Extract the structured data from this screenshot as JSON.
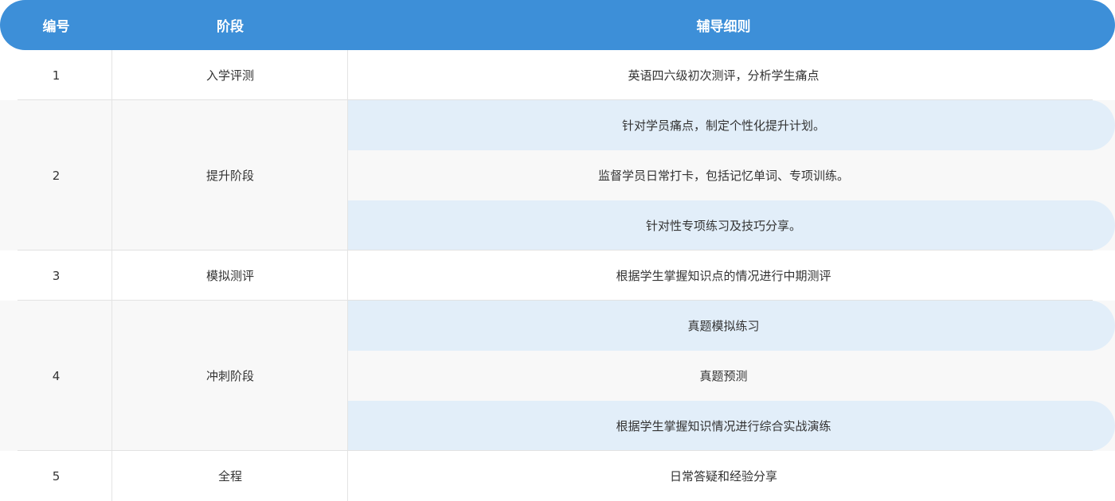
{
  "header": {
    "col_num": "编号",
    "col_stage": "阶段",
    "col_detail": "辅导细则"
  },
  "rows": [
    {
      "num": "1",
      "stage": "入学评测",
      "details": [
        "英语四六级初次测评，分析学生痛点"
      ]
    },
    {
      "num": "2",
      "stage": "提升阶段",
      "details": [
        "针对学员痛点，制定个性化提升计划。",
        "监督学员日常打卡，包括记忆单词、专项训练。",
        "针对性专项练习及技巧分享。"
      ]
    },
    {
      "num": "3",
      "stage": "模拟测评",
      "details": [
        "根据学生掌握知识点的情况进行中期测评"
      ]
    },
    {
      "num": "4",
      "stage": "冲刺阶段",
      "details": [
        "真题模拟练习",
        "真题预测",
        "根据学生掌握知识情况进行综合实战演练"
      ]
    },
    {
      "num": "5",
      "stage": "全程",
      "details": [
        "日常答疑和经验分享"
      ]
    }
  ],
  "colors": {
    "header_bg": "#3d8fd8",
    "header_text": "#ffffff",
    "alt_row_bg": "#f8f8f8",
    "highlight_bg": "#e2eef9",
    "text": "#333333"
  }
}
